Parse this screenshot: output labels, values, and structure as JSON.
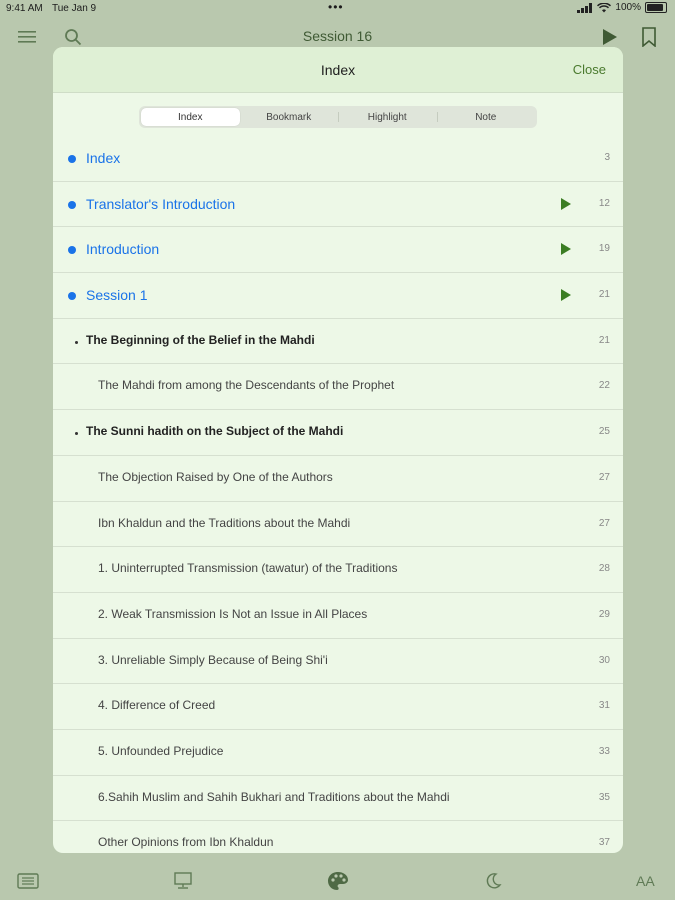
{
  "status": {
    "time": "9:41 AM",
    "date": "Tue Jan 9",
    "battery": "100%"
  },
  "topnav": {
    "title": "Session 16"
  },
  "sheet": {
    "title": "Index",
    "close_label": "Close",
    "tabs": [
      "Index",
      "Bookmark",
      "Highlight",
      "Note"
    ],
    "active_tab": "Index",
    "items": [
      {
        "label": "Index",
        "page": "3",
        "level": 0,
        "audio": false
      },
      {
        "label": "Translator's Introduction",
        "page": "12",
        "level": 0,
        "audio": true
      },
      {
        "label": "Introduction",
        "page": "19",
        "level": 0,
        "audio": true
      },
      {
        "label": "Session 1",
        "page": "21",
        "level": 0,
        "audio": true
      },
      {
        "label": "The Beginning of the Belief in the Mahdi",
        "page": "21",
        "level": 1,
        "audio": false
      },
      {
        "label": "The Mahdi from among the Descendants of the Prophet",
        "page": "22",
        "level": 2,
        "audio": false
      },
      {
        "label": "The Sunni hadith on the Subject of the Mahdi",
        "page": "25",
        "level": 1,
        "audio": false
      },
      {
        "label": "The Objection Raised by One of the Authors",
        "page": "27",
        "level": 2,
        "audio": false
      },
      {
        "label": "Ibn Khaldun and the Traditions about the Mahdi",
        "page": "27",
        "level": 2,
        "audio": false
      },
      {
        "label": "1. Uninterrupted Transmission (tawatur) of the Traditions",
        "page": "28",
        "level": 2,
        "audio": false
      },
      {
        "label": "2. Weak Transmission Is Not an Issue in All Places",
        "page": "29",
        "level": 2,
        "audio": false
      },
      {
        "label": "3. Unreliable Simply Because of Being Shi'i",
        "page": "30",
        "level": 2,
        "audio": false
      },
      {
        "label": "4. Difference of Creed",
        "page": "31",
        "level": 2,
        "audio": false
      },
      {
        "label": "5. Unfounded Prejudice",
        "page": "33",
        "level": 2,
        "audio": false
      },
      {
        "label": "6.Sahih Muslim and Sahih Bukhari and Traditions about the Mahdi",
        "page": "35",
        "level": 2,
        "audio": false
      },
      {
        "label": "Other Opinions from Ibn Khaldun",
        "page": "37",
        "level": 2,
        "audio": false
      }
    ]
  },
  "bottombar": {
    "font_size_label": "AA"
  },
  "icons": [
    "menu-icon",
    "search-icon",
    "play-icon",
    "bookmark-icon",
    "contents-icon",
    "display-icon",
    "palette-icon",
    "moon-icon",
    "font-size-icon"
  ],
  "colors": {
    "accent": "#4a7a2e",
    "link": "#1a73e8",
    "play": "#3b7d23",
    "sheet_bg": "#edf8e7",
    "dim_bg": "#b9c8ae"
  }
}
